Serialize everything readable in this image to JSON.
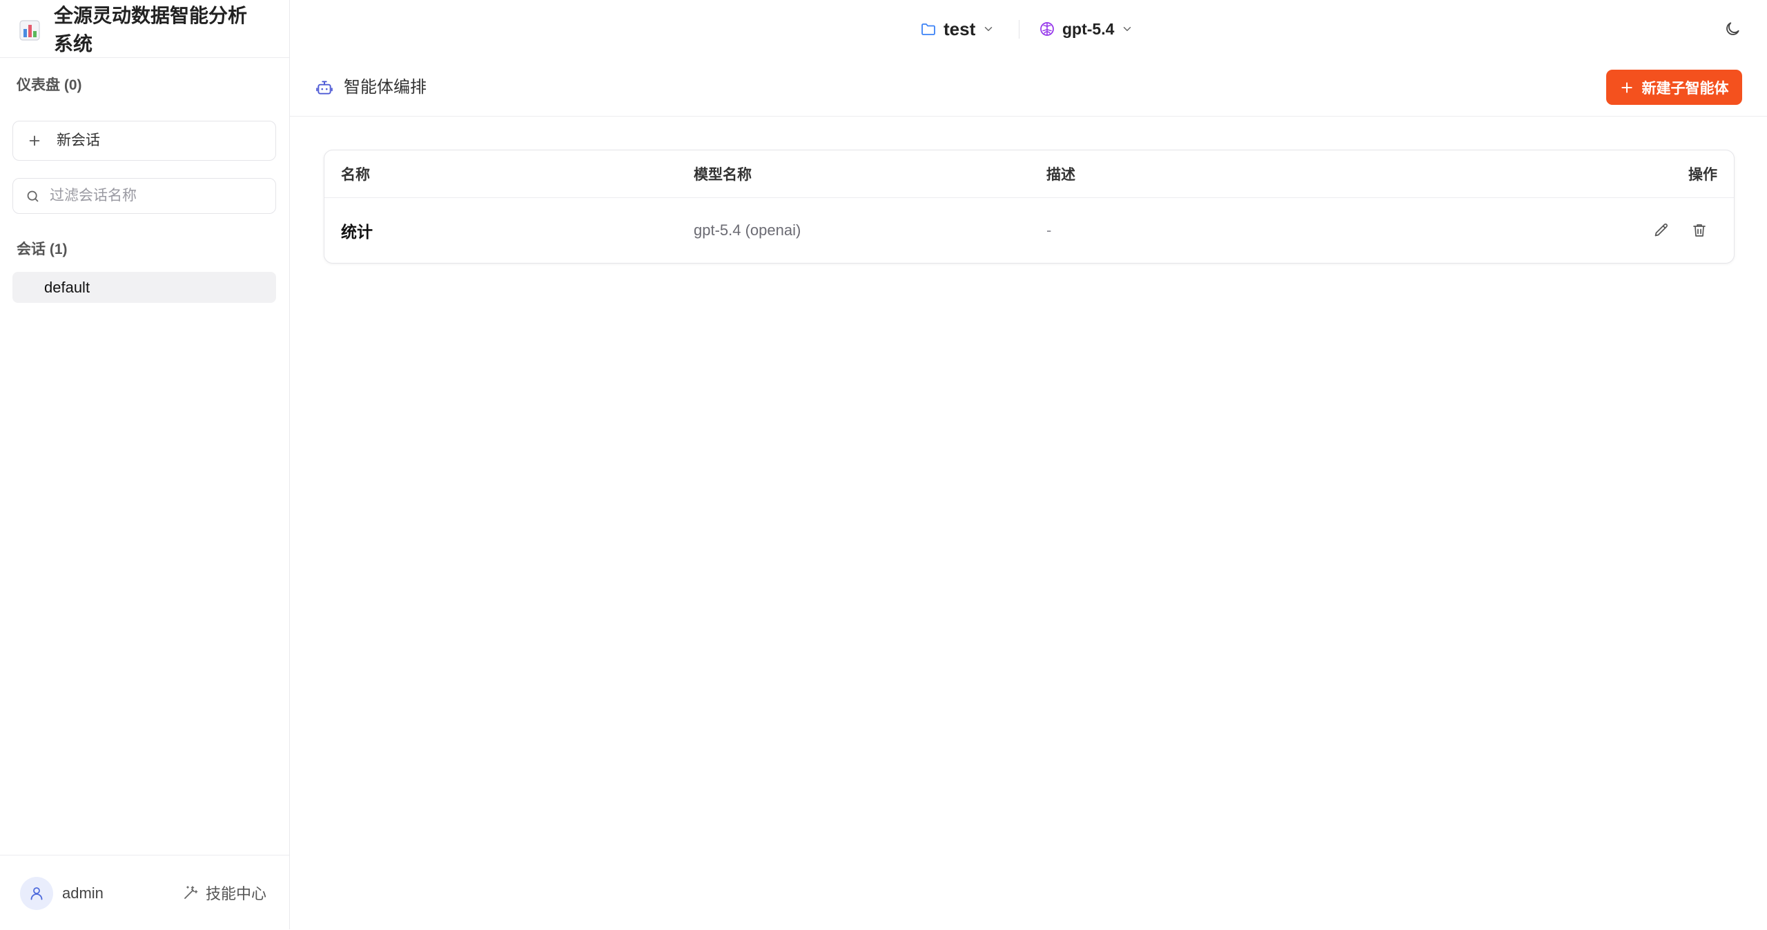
{
  "app": {
    "title": "全源灵动数据智能分析系统"
  },
  "sidebar": {
    "dashboard_label": "仪表盘 (0)",
    "new_chat_label": "新会话",
    "search": {
      "placeholder": "过滤会话名称"
    },
    "sessions_label": "会话 (1)",
    "sessions": [
      {
        "name": "default",
        "selected": true
      }
    ],
    "user": {
      "name": "admin"
    },
    "skills_label": "技能中心"
  },
  "topbar": {
    "project": "test",
    "model": "gpt-5.4"
  },
  "page": {
    "title": "智能体编排",
    "new_agent_button": "新建子智能体"
  },
  "table": {
    "columns": [
      "名称",
      "模型名称",
      "描述",
      "操作"
    ],
    "rows": [
      {
        "name": "统计",
        "model": "gpt-5.4 (openai)",
        "description": "-"
      }
    ]
  },
  "icons": {
    "brand": "bar-chart-icon",
    "new_chat": "plus-icon",
    "search": "search-icon",
    "project": "folder-icon",
    "model": "brain-icon",
    "theme": "moon-icon",
    "page": "robot-icon",
    "edit": "pencil-icon",
    "delete": "trash-icon",
    "user": "user-icon",
    "skills": "wand-icon"
  },
  "colors": {
    "accent": "#f4511e",
    "folder_icon": "#3b82f6",
    "brain_icon": "#9333ea",
    "robot_icon": "#4f5bd5",
    "selected_session_bg": "#f1f1f3"
  }
}
